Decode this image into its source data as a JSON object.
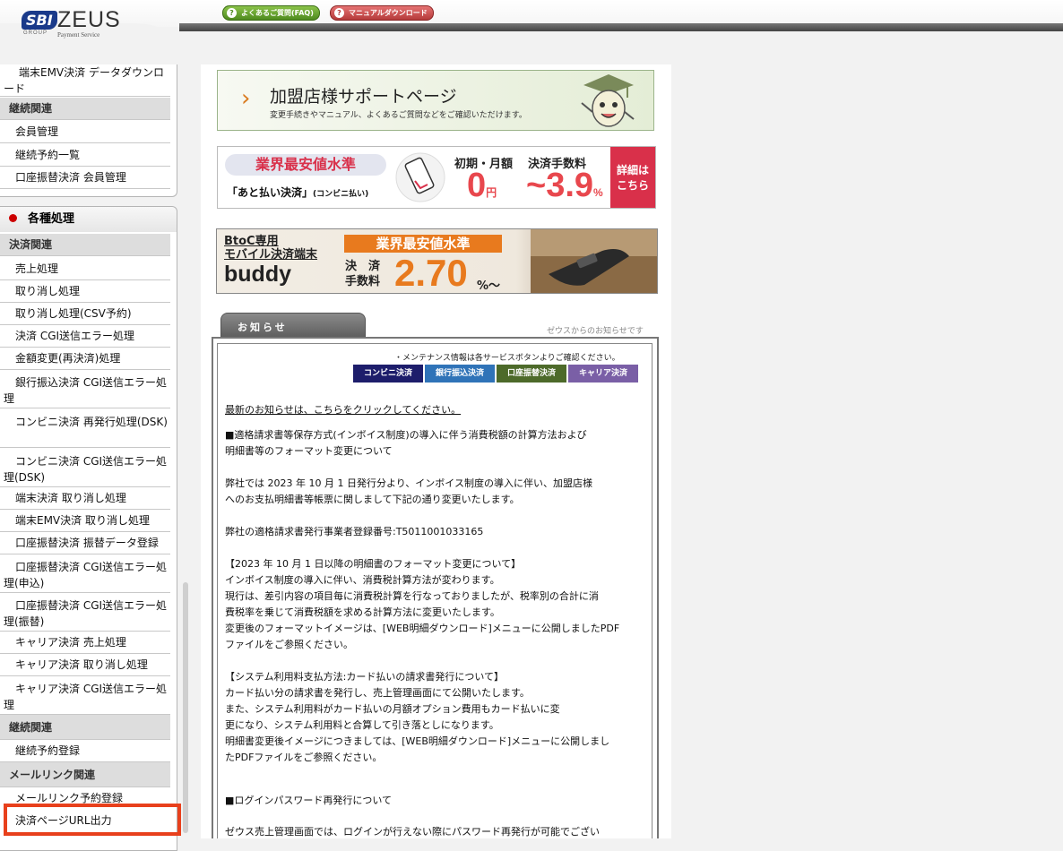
{
  "header": {
    "logo_sbi": "SBI",
    "logo_group": "GROUP",
    "logo_zeus": "ZEUS",
    "logo_ps": "Payment Service",
    "faq_label": "よくあるご質問(FAQ)",
    "manual_label": "マニュアルダウンロード"
  },
  "sidebar": {
    "top_items": [
      {
        "label": "端末EMV決済 データダウンロード"
      }
    ],
    "top_group": "継続関連",
    "top_group_items": [
      {
        "label": "会員管理"
      },
      {
        "label": "継続予約一覧"
      },
      {
        "label": "口座振替決済 会員管理"
      }
    ],
    "section_title": "各種処理",
    "group_payment": "決済関連",
    "payment_items": [
      {
        "label": "売上処理"
      },
      {
        "label": "取り消し処理"
      },
      {
        "label": "取り消し処理(CSV予約)"
      },
      {
        "label": "決済 CGI送信エラー処理"
      },
      {
        "label": "金額変更(再決済)処理"
      },
      {
        "label": "銀行振込決済 CGI送信エラー処理"
      },
      {
        "label": "コンビニ決済 再発行処理(DSK)"
      },
      {
        "label": "コンビニ決済 CGI送信エラー処理(DSK)"
      },
      {
        "label": "端末決済 取り消し処理"
      },
      {
        "label": "端末EMV決済 取り消し処理"
      },
      {
        "label": "口座振替決済 振替データ登録"
      },
      {
        "label": "口座振替決済 CGI送信エラー処理(申込)"
      },
      {
        "label": "口座振替決済 CGI送信エラー処理(振替)"
      },
      {
        "label": "キャリア決済 売上処理"
      },
      {
        "label": "キャリア決済 取り消し処理"
      },
      {
        "label": "キャリア決済 CGI送信エラー処理"
      }
    ],
    "group_continuous": "継続関連",
    "continuous_items": [
      {
        "label": "継続予約登録"
      }
    ],
    "group_mail": "メールリンク関連",
    "mail_items": [
      {
        "label": "メールリンク予約登録"
      },
      {
        "label": "決済ページURL出力"
      }
    ]
  },
  "banners": {
    "support_title": "加盟店様サポートページ",
    "support_sub": "変更手続きやマニュアル、よくあるご質問などをご確認いただけます。",
    "conv_pill": "業界最安値水準",
    "conv_sub": "「あと払い決済」",
    "conv_sub_small": "(コンビニ払い)",
    "conv_l1": "初期・月額",
    "conv_l2": "決済手数料",
    "conv_n1": "0",
    "conv_n1_unit": "円",
    "conv_n2": "~3.9",
    "conv_n2_unit": "%",
    "conv_detail1": "詳細は",
    "conv_detail2": "こちら",
    "buddy_l1": "BtoC専用",
    "buddy_l2": "モバイル決済端末",
    "buddy_name": "buddy",
    "buddy_orange": "業界最安値水準",
    "buddy_fee1": "決　済",
    "buddy_fee2": "手数料",
    "buddy_rate": "2.70",
    "buddy_pct": "%～"
  },
  "news": {
    "tab_label": "お知らせ",
    "note": "ゼウスからのお知らせです",
    "maint_note": "・メンテナンス情報は各サービスボタンよりご確認ください。",
    "services": [
      "コンビニ決済",
      "銀行振込決済",
      "口座振替決済",
      "キャリア決済"
    ],
    "latest_link": "最新のお知らせは、こちらをクリックしてください。",
    "p1_l1": "■適格請求書等保存方式(インボイス制度)の導入に伴う消費税額の計算方法および",
    "p1_l2": "明細書等のフォーマット変更について",
    "p2_l1": "弊社では 2023 年 10 月 1 日発行分より、インボイス制度の導入に伴い、加盟店様",
    "p2_l2": "へのお支払明細書等帳票に関しまして下記の通り変更いたします。",
    "p3": "弊社の適格請求書発行事業者登録番号:T5011001033165",
    "p4_l1": "【2023 年 10 月 1 日以降の明細書のフォーマット変更について】",
    "p4_l2": "インボイス制度の導入に伴い、消費税計算方法が変わります。",
    "p4_l3": "現行は、差引内容の項目毎に消費税計算を行なっておりましたが、税率別の合計に消",
    "p4_l4": "費税率を乗じて消費税額を求める計算方法に変更いたします。",
    "p4_l5": "変更後のフォーマットイメージは、[WEB明細ダウンロード]メニューに公開しましたPDF",
    "p4_l6": "ファイルをご参照ください。",
    "p5_l1": "【システム利用料支払方法:カード払いの請求書発行について】",
    "p5_l2": "カード払い分の請求書を発行し、売上管理画面にて公開いたします。",
    "p5_l3": "また、システム利用料がカード払いの月額オプション費用もカード払いに変",
    "p5_l4": "更になり、システム利用料と合算して引き落としになります。",
    "p5_l5": "明細書変更後イメージにつきましては、[WEB明細ダウンロード]メニューに公開しまし",
    "p5_l6": "たPDFファイルをご参照ください。",
    "p6": "■ログインパスワード再発行について",
    "p7": "ゼウス売上管理画面では、ログインが行えない際にパスワード再発行が可能でござい"
  }
}
